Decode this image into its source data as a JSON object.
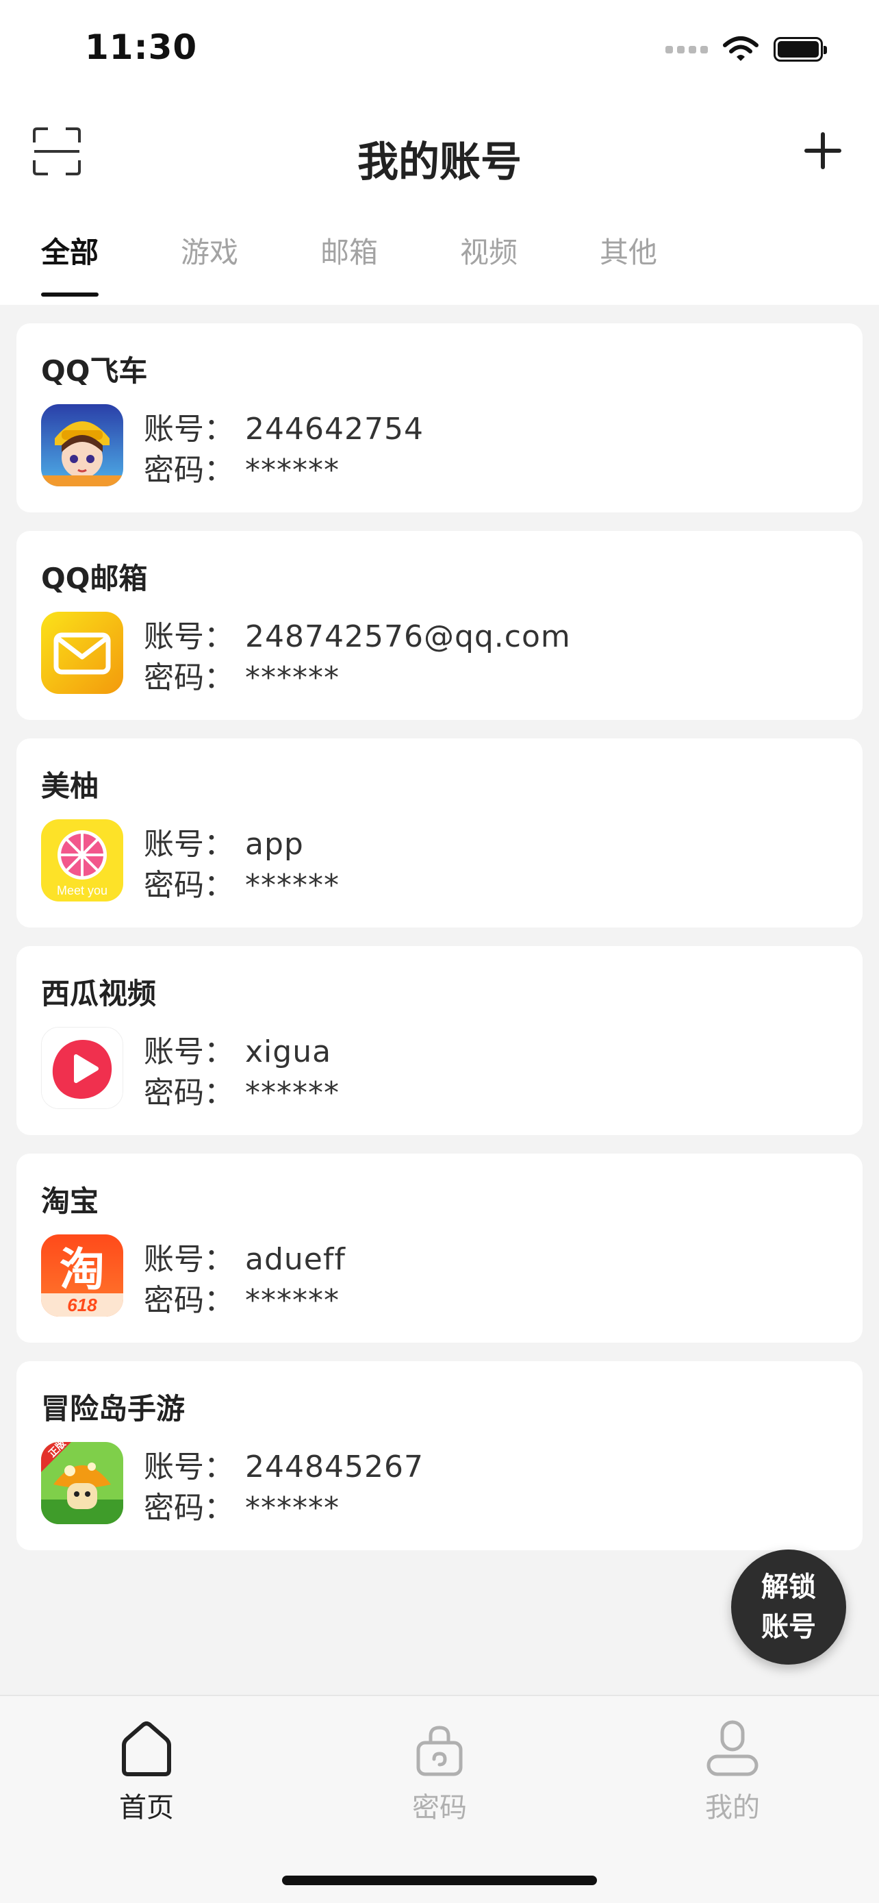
{
  "status": {
    "time": "11:30"
  },
  "header": {
    "title": "我的账号"
  },
  "tabs": [
    {
      "label": "全部",
      "active": true
    },
    {
      "label": "游戏",
      "active": false
    },
    {
      "label": "邮箱",
      "active": false
    },
    {
      "label": "视频",
      "active": false
    },
    {
      "label": "其他",
      "active": false
    }
  ],
  "labels": {
    "account": "账号：",
    "password": "密码："
  },
  "accounts": [
    {
      "name": "QQ飞车",
      "account": "244642754",
      "password": "******",
      "icon": "qq-speed-icon"
    },
    {
      "name": "QQ邮箱",
      "account": "248742576@qq.com",
      "password": "******",
      "icon": "qq-mail-icon"
    },
    {
      "name": "美柚",
      "account": "app",
      "password": "******",
      "icon": "meetyou-icon",
      "icon_text": "Meet you"
    },
    {
      "name": "西瓜视频",
      "account": "xigua",
      "password": "******",
      "icon": "xigua-icon"
    },
    {
      "name": "淘宝",
      "account": "adueff",
      "password": "******",
      "icon": "taobao-icon",
      "icon_text": "淘",
      "icon_sub": "618"
    },
    {
      "name": "冒险岛手游",
      "account": "244845267",
      "password": "******",
      "icon": "maplestory-icon",
      "icon_text": "正版"
    }
  ],
  "fab": {
    "line1": "解锁",
    "line2": "账号"
  },
  "tabbar": [
    {
      "label": "首页",
      "icon": "home-icon",
      "active": true
    },
    {
      "label": "密码",
      "icon": "lock-icon",
      "active": false
    },
    {
      "label": "我的",
      "icon": "user-icon",
      "active": false
    }
  ],
  "colors": {
    "accent": "#111111",
    "inactive": "#a3a3a3",
    "background": "#f3f3f3",
    "fab": "#2d2d2d"
  }
}
